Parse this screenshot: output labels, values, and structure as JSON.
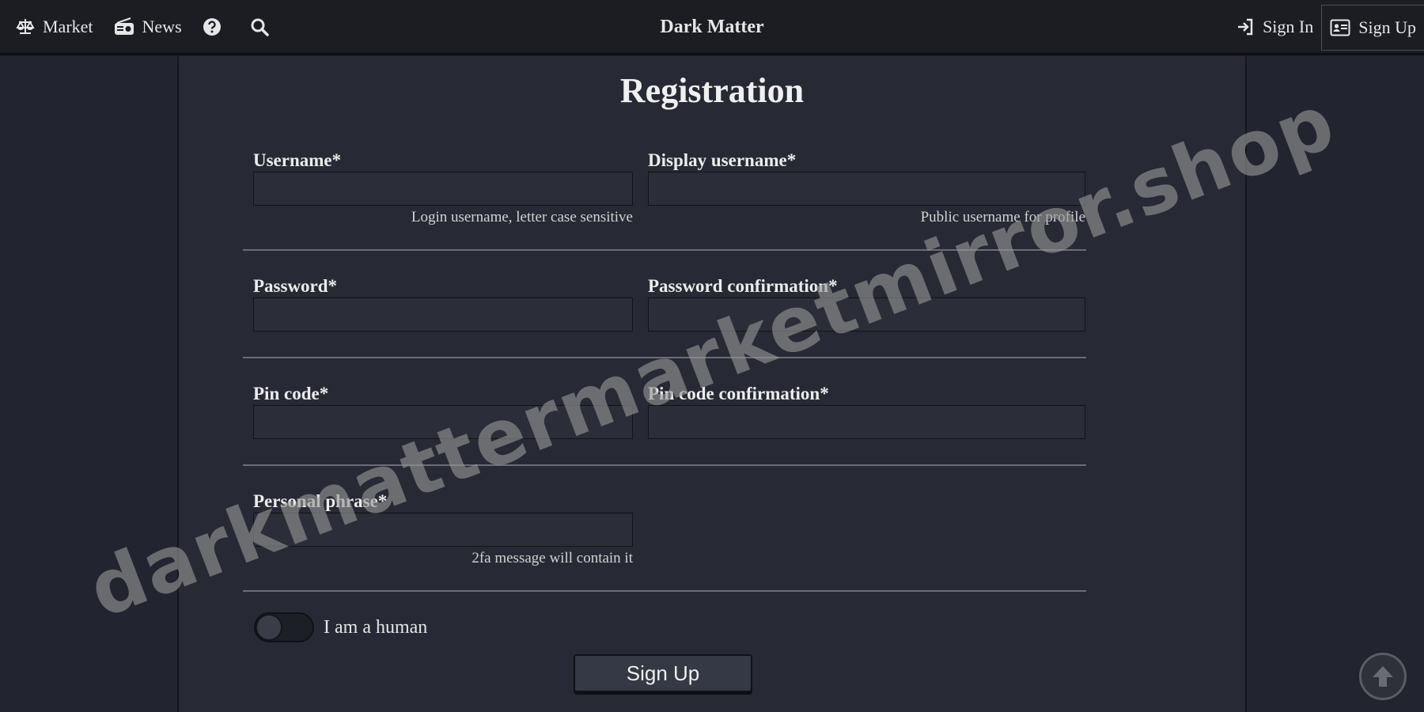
{
  "nav": {
    "brand": "Dark Matter",
    "left": [
      {
        "label": "Market",
        "icon": "scale-icon"
      },
      {
        "label": "News",
        "icon": "radio-icon"
      },
      {
        "label": "",
        "icon": "question-icon"
      },
      {
        "label": "",
        "icon": "search-icon"
      }
    ],
    "sign_in": "Sign In",
    "sign_up": "Sign Up"
  },
  "form": {
    "title": "Registration",
    "username_label": "Username*",
    "username_hint": "Login username, letter case sensitive",
    "display_label": "Display username*",
    "display_hint": "Public username for profile",
    "password_label": "Password*",
    "password_confirm_label": "Password confirmation*",
    "pin_label": "Pin code*",
    "pin_confirm_label": "Pin code confirmation*",
    "phrase_label": "Personal phrase*",
    "phrase_hint": "2fa message will contain it",
    "human_label": "I am a human",
    "human_checked": false,
    "submit_label": "Sign Up"
  },
  "watermark": "darkmattermarketmirror.shop",
  "colors": {
    "background": "#22252f",
    "panel": "#272a34",
    "topbar": "#1b1d23"
  }
}
